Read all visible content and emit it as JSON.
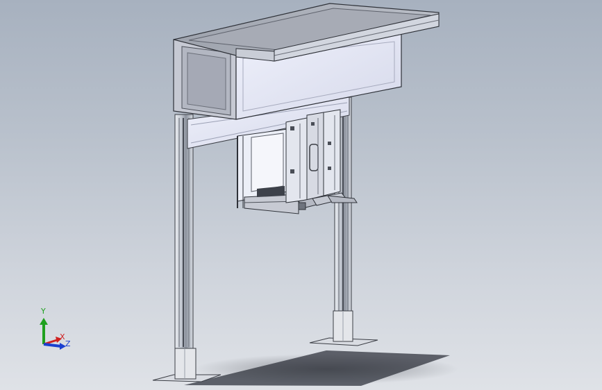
{
  "viewport": {
    "background_top": "#a7b1bf",
    "background_bottom": "#dfe2e7"
  },
  "triad": {
    "x_label": "X",
    "y_label": "Y",
    "z_label": "Z",
    "x_color": "#d02020",
    "y_color": "#1fa01f",
    "z_color": "#1a3fd0"
  },
  "model": {
    "description_icon": "cad-assembly-gantry-frame"
  }
}
